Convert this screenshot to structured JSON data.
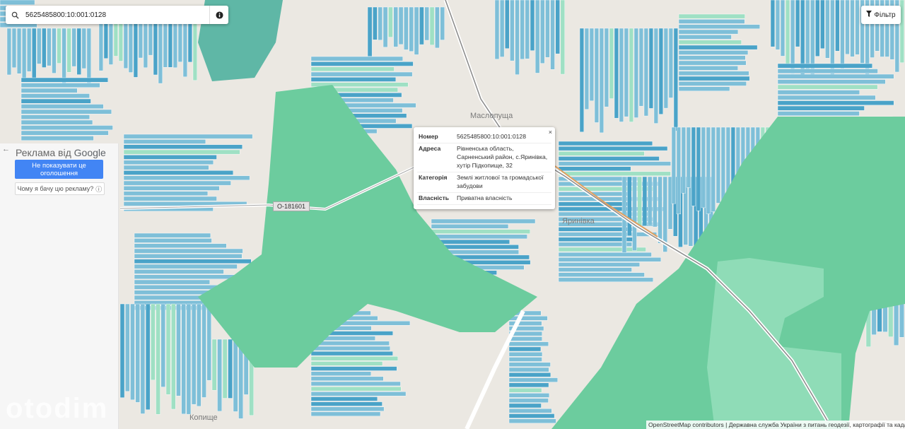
{
  "search": {
    "value": "5625485800:10:001:0128",
    "search_icon": "search-icon",
    "info_icon": "info-icon"
  },
  "filter": {
    "label": "Фільтр",
    "icon": "filter-icon"
  },
  "ad": {
    "title_prefix": "Реклама від",
    "title_brand": "Google",
    "stop_button": "Не показувати це оголошення",
    "why_button": "Чому я бачу цю рекламу?"
  },
  "map": {
    "place_labels": [
      "Маслопуща",
      "Яринівка",
      "Копище"
    ],
    "road_label": "О-181601",
    "colors": {
      "forest": "#6ccc9e",
      "parcel": "#7ebfd8",
      "parcel_dark": "#4aa3c8",
      "land": "#ebe8e2",
      "road": "#9b9b9b",
      "highlight_road": "#e0a060"
    }
  },
  "popup": {
    "close": "×",
    "rows": [
      {
        "key": "Номер",
        "value": "5625485800:10:001:0128"
      },
      {
        "key": "Адреса",
        "value": "Рівненська область, Сарненський район, с.Яринівка, хутір Підкопище, 32"
      },
      {
        "key": "Категорія",
        "value": "Землі житлової та громадської забудови"
      },
      {
        "key": "Власність",
        "value": "Приватна власність"
      }
    ]
  },
  "attribution": "OpenStreetMap contributors | Державна служба України з питань геодезії, картографії та кадастру",
  "watermark": "otodim"
}
